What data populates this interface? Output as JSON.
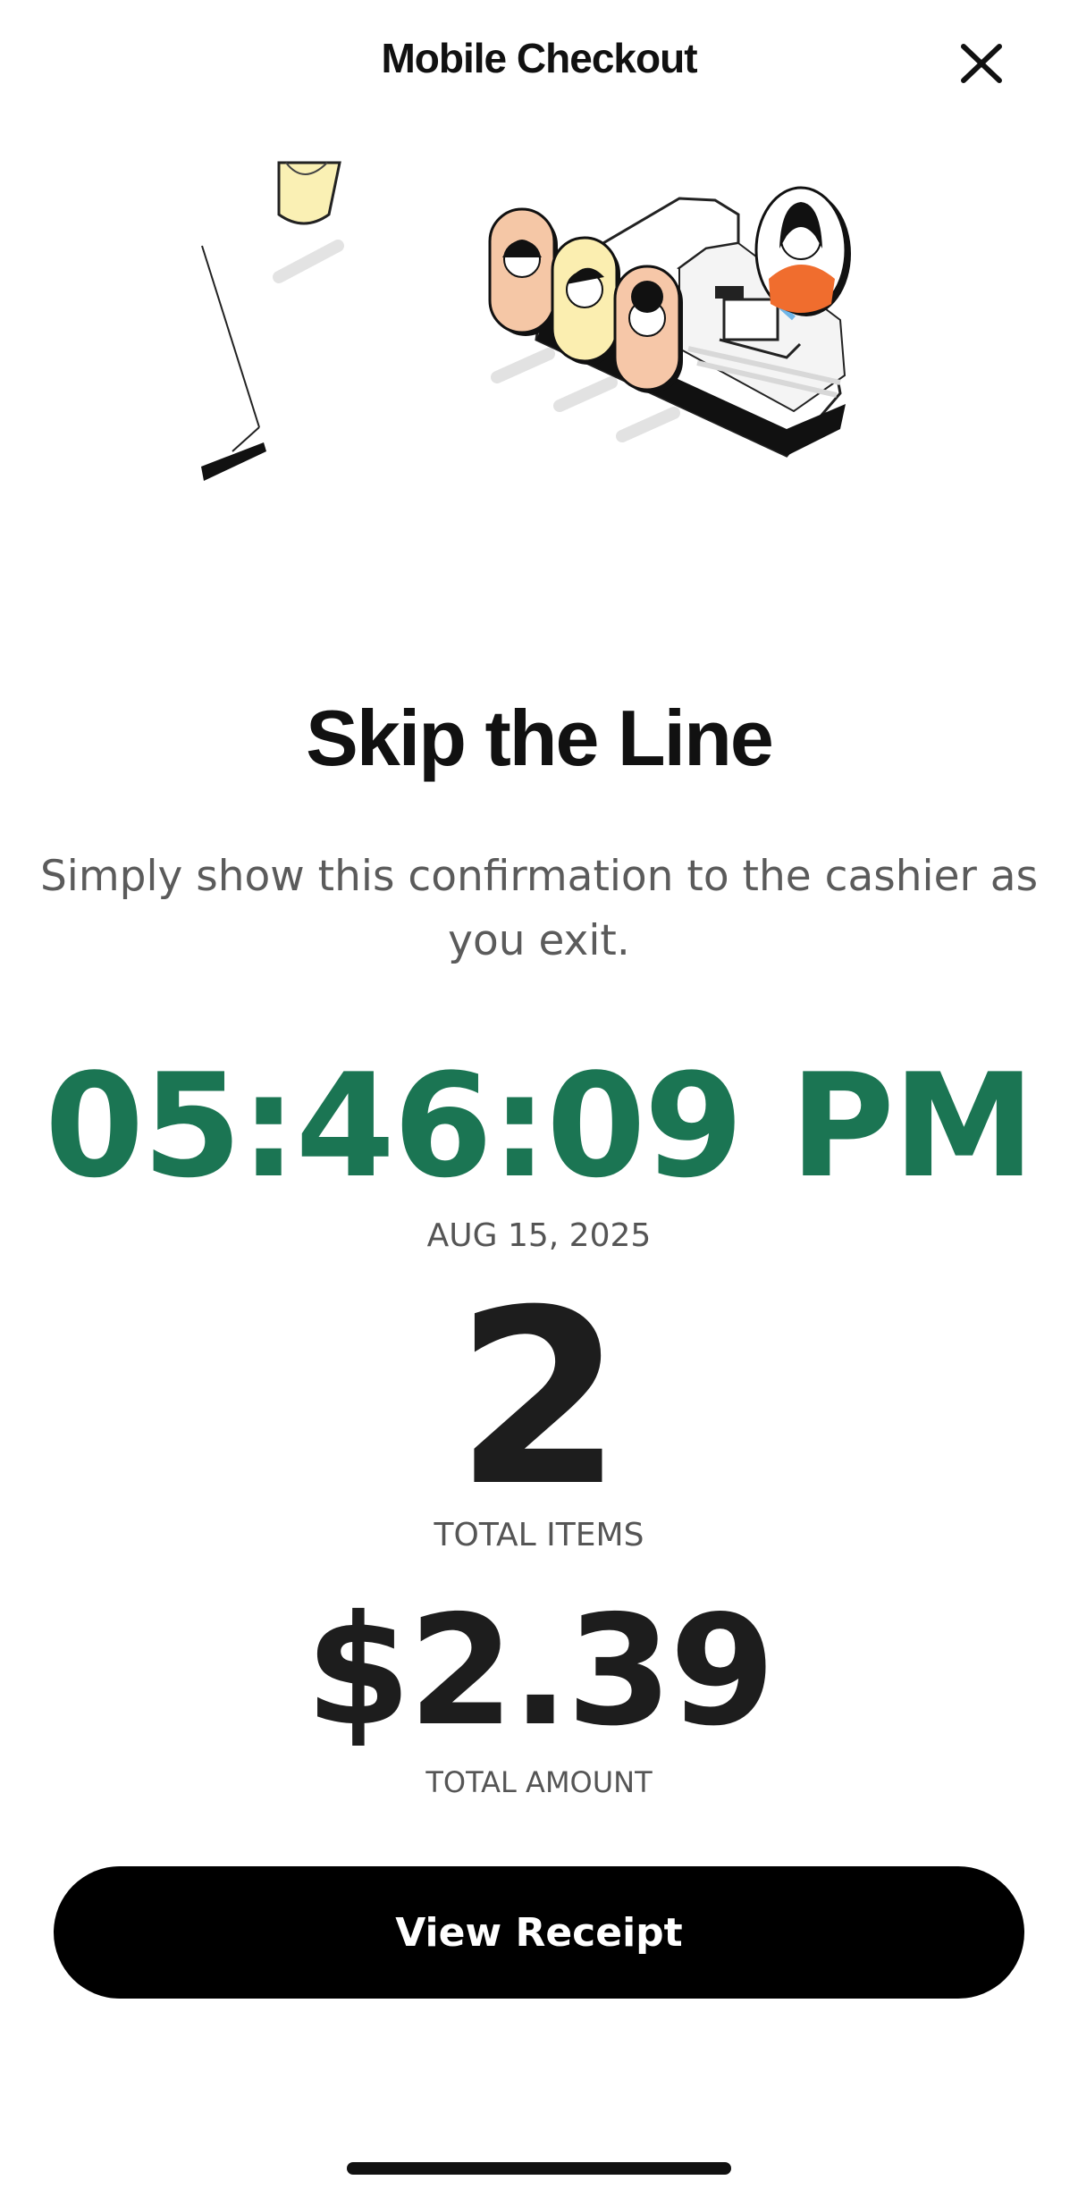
{
  "header": {
    "title": "Mobile Checkout",
    "close_icon": "close-icon"
  },
  "illustration": {
    "icon": "checkout-counter-illustration"
  },
  "confirmation": {
    "headline": "Skip the Line",
    "subtext": "Simply show this confirmation to the cashier as you exit.",
    "time": "05:46:09 PM",
    "date": "AUG 15, 2025",
    "total_items": "2",
    "total_items_label": "TOTAL ITEMS",
    "total_amount": "$2.39",
    "total_amount_label": "TOTAL AMOUNT"
  },
  "actions": {
    "view_receipt_label": "View Receipt"
  },
  "colors": {
    "accent_green": "#1b7553",
    "button_black": "#000000",
    "text_dark": "#1d1d1d",
    "text_muted": "#555555"
  }
}
